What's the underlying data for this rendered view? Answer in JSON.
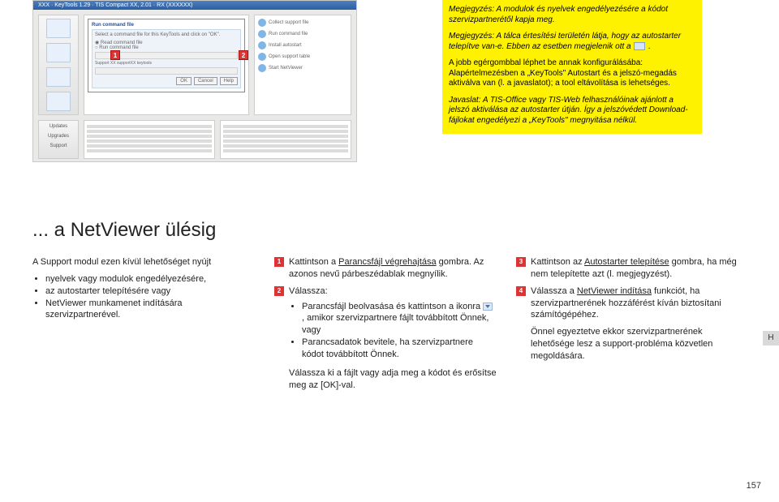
{
  "screenshot": {
    "window_title": "XXX · KeyTools 1.29 · TIS Compact XX, 2.01 · RX (XXXXXX)",
    "run_header": "Run command file",
    "run_instruction": "Select a command file for this KeyTools and click on \"OK\".",
    "radio_read": "Read command file",
    "radio_run": "Run command file",
    "support_line": "Support XX supportXX keytools",
    "btn_ok": "OK",
    "btn_cancel": "Cancel",
    "btn_help": "Help",
    "right_items": [
      "Collect support file",
      "Run command file",
      "Install autostart",
      "Open support table",
      "Start NetViewer"
    ],
    "bottom_left": [
      "Updates",
      "Upgrades",
      "Support"
    ],
    "callouts": {
      "one": "1",
      "two": "2"
    }
  },
  "notes": {
    "p1": "Megjegyzés: A modulok és nyelvek engedélyezésére a kódot szervizpartnerétől kapja meg.",
    "p2_a": "Megjegyzés: A tálca értesítési területén látja, hogy az autostarter telepítve van-e. Ebben az esetben megjelenik ott a ",
    "p2_b": ".",
    "p3": "A jobb egérgombbal léphet be annak konfigurálásába: Alapértelmezésben a „KeyTools\" Autostart és a jelszó-megadás aktiválva van (l. a javaslatot); a tool eltávolítása is lehetséges.",
    "p4": "Javaslat: A TIS-Office vagy TIS-Web felhasználóinak ajánlott a jelszó aktiválása az autostarter útján. Így a jelszóvédett Download-fájlokat engedélyezi a „KeyTools\" megnyitása nélkül."
  },
  "article": {
    "heading": "... a NetViewer ülésig",
    "col1": {
      "intro": "A Support modul ezen kívül lehetőséget nyújt",
      "bullets": [
        "nyelvek vagy modulok engedélyezésére,",
        "az autostarter telepítésére vagy",
        "NetViewer munkamenet indítására szervizpartnerével."
      ]
    },
    "col2": {
      "step1_num": "1",
      "step1": "Kattintson a Parancsfájl végrehajtása gombra. Az azonos nevű párbeszédablak megnyílik.",
      "step2_num": "2",
      "step2_label": "Válassza:",
      "step2_b1a": "Parancsfájl beolvasása és kattintson a ikonra ",
      "step2_b1b": ", amikor szervizpartnere fájlt továbbított Önnek, vagy",
      "step2_b2": "Parancsadatok bevitele, ha szervizpartnere kódot továbbított Önnek.",
      "tail": "Válassza ki a fájlt vagy adja meg a kódot és erősítse meg az [OK]-val."
    },
    "col3": {
      "step3_num": "3",
      "step3": "Kattintson az Autostarter telepítése gombra, ha még nem telepítette azt (l. megjegyzést).",
      "step4_num": "4",
      "step4a": "Válassza a NetViewer indítása funkciót, ha szervizpartnerének hozzáférést kíván biztosítani számítógépéhez.",
      "step4b": "Önnel egyeztetve ekkor szervizpartnerének lehetősége lesz a support-probléma közvetlen megoldására."
    }
  },
  "side_tab": "H",
  "page_number": "157"
}
